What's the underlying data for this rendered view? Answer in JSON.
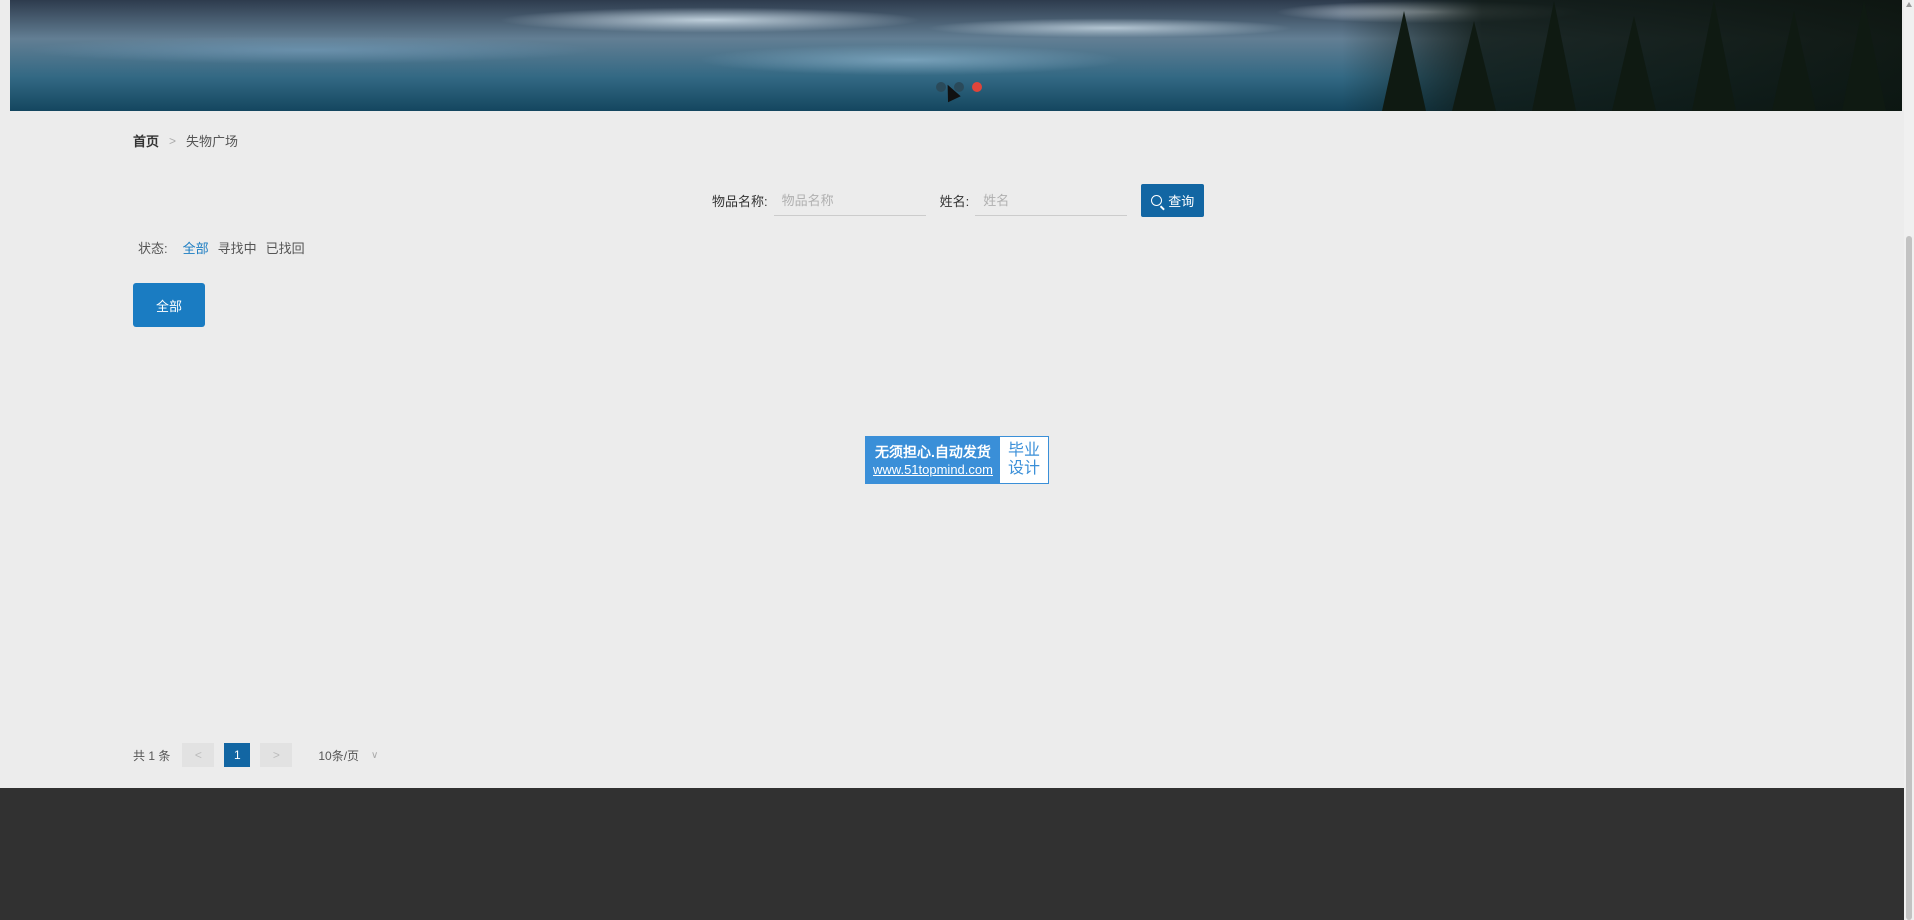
{
  "banner": {
    "slides": 3,
    "active_slide": 3
  },
  "breadcrumb": {
    "home": "首页",
    "separator": ">",
    "current": "失物广场"
  },
  "search": {
    "item_name_label": "物品名称:",
    "item_name_placeholder": "物品名称",
    "name_label": "姓名:",
    "name_placeholder": "姓名",
    "query_button": "查询"
  },
  "status_filter": {
    "label": "状态:",
    "options": [
      "全部",
      "寻找中",
      "已找回"
    ],
    "active": "全部"
  },
  "category_button": "全部",
  "watermark": {
    "line1": "无须担心.自动发货",
    "line2": "www.51topmind.com",
    "right1": "毕业",
    "right2": "设计"
  },
  "pagination": {
    "total": "共 1 条",
    "prev": "<",
    "page": "1",
    "next": ">",
    "page_size": "10条/页",
    "page_size_chevron": "∨"
  },
  "colors": {
    "primary": "#1266a3",
    "accent": "#1a7cc2",
    "footer": "#313131",
    "active_dot": "#e0443a"
  }
}
